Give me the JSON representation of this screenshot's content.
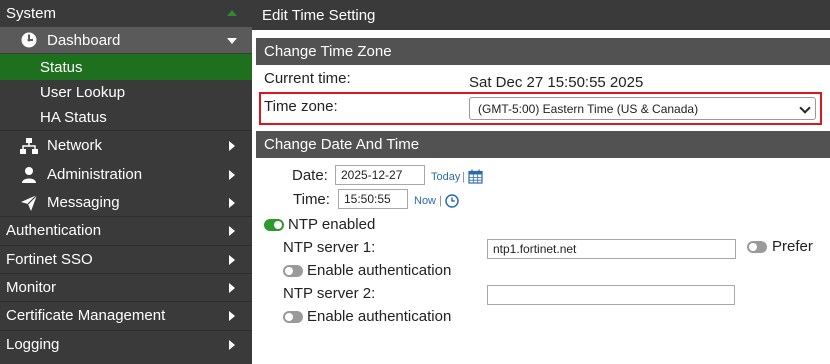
{
  "sidebar": {
    "system": "System",
    "dashboard": "Dashboard",
    "status": "Status",
    "user_lookup": "User Lookup",
    "ha_status": "HA Status",
    "network": "Network",
    "administration": "Administration",
    "messaging": "Messaging",
    "authentication": "Authentication",
    "fortinet_sso": "Fortinet SSO",
    "monitor": "Monitor",
    "certificate_management": "Certificate Management",
    "logging": "Logging"
  },
  "page": {
    "title": "Edit Time Setting"
  },
  "time_zone_section": {
    "heading": "Change Time Zone",
    "current_time_label": "Current time:",
    "current_time_value": "Sat Dec 27 15:50:55 2025",
    "time_zone_label": "Time zone:",
    "time_zone_value": "(GMT-5:00) Eastern Time (US & Canada)"
  },
  "date_time_section": {
    "heading": "Change Date And Time",
    "date_label": "Date:",
    "date_value": "2025-12-27",
    "today_link": "Today",
    "time_label": "Time:",
    "time_value": "15:50:55",
    "now_link": "Now",
    "separator": "|",
    "ntp_enabled_label": "NTP enabled",
    "ntp_server1_label": "NTP server 1:",
    "ntp_server1_value": "ntp1.fortinet.net",
    "prefer_label": "Prefer",
    "enable_auth_label": "Enable authentication",
    "ntp_server2_label": "NTP server 2:",
    "ntp_server2_value": "",
    "enable_auth2_label": "Enable authentication"
  },
  "colors": {
    "sidebar_bg": "#3a3a3a",
    "active_green": "#1e6f1e",
    "highlight_red": "#e0141b",
    "link_blue": "#2a6bb0"
  },
  "toggles": {
    "ntp_enabled": true,
    "prefer": false,
    "enable_auth_1": false,
    "enable_auth_2": false
  }
}
